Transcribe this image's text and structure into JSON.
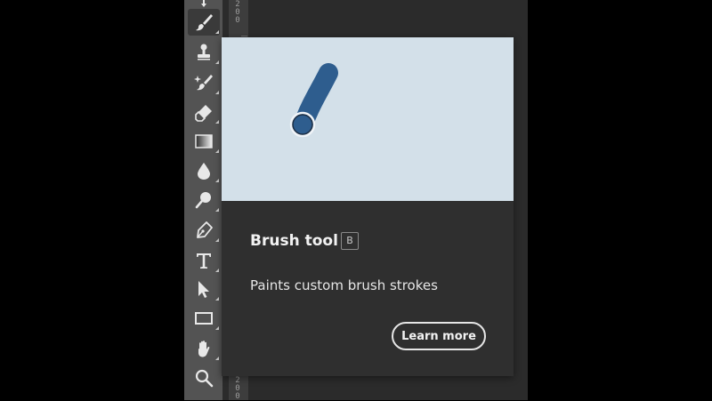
{
  "toolbar": {
    "tools": [
      {
        "icon": "move-icon",
        "active": false
      },
      {
        "icon": "brush-icon",
        "active": true
      },
      {
        "icon": "clone-stamp-icon",
        "active": false
      },
      {
        "icon": "healing-brush-icon",
        "active": false
      },
      {
        "icon": "eraser-icon",
        "active": false
      },
      {
        "icon": "gradient-icon",
        "active": false
      },
      {
        "icon": "blur-drop-icon",
        "active": false
      },
      {
        "icon": "dodge-icon",
        "active": false
      },
      {
        "icon": "pen-icon",
        "active": false
      },
      {
        "icon": "type-icon",
        "active": false
      },
      {
        "icon": "path-selection-icon",
        "active": false
      },
      {
        "icon": "rectangle-icon",
        "active": false
      },
      {
        "icon": "hand-icon",
        "active": false
      },
      {
        "icon": "zoom-icon",
        "active": false
      }
    ]
  },
  "ruler": {
    "top_digits": "200",
    "bottom_digits": "200"
  },
  "tooltip": {
    "title": "Brush tool",
    "shortcut": "B",
    "description": "Paints custom brush strokes",
    "learn_more_label": "Learn more",
    "preview_bg": "#d3e0e9",
    "stroke_color": "#2e5d8e"
  }
}
